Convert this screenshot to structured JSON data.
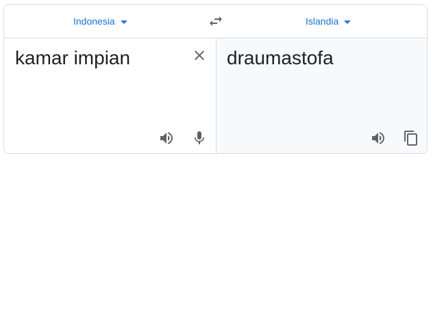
{
  "languages": {
    "source": "Indonesia",
    "target": "Islandia"
  },
  "source_panel": {
    "text": "kamar impian"
  },
  "target_panel": {
    "text": "draumastofa"
  },
  "icons": {
    "swap": "swap-arrows-icon",
    "clear": "close-icon",
    "listen_source": "speaker-icon",
    "mic": "microphone-icon",
    "listen_target": "speaker-icon",
    "copy": "copy-icon"
  },
  "colors": {
    "accent": "#1a73e8",
    "icon": "#5f6368",
    "text": "#202124",
    "border": "#dadce0",
    "target_bg": "#f8f9fa"
  }
}
